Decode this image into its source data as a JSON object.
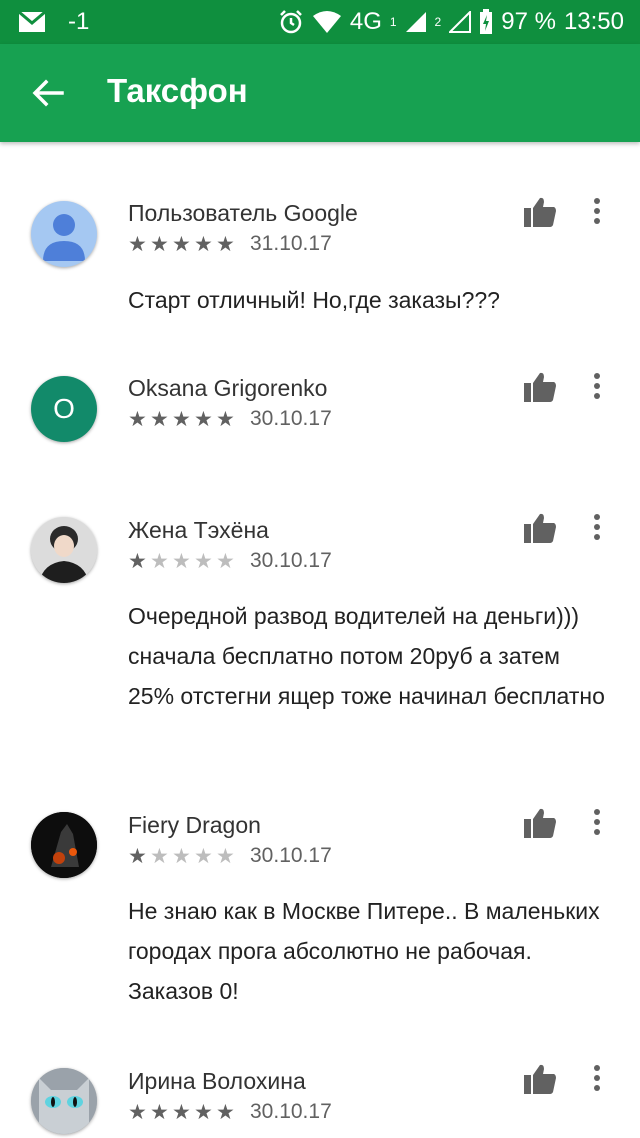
{
  "status_bar": {
    "notification_badge": "-1",
    "network": "4G",
    "sim1": "1",
    "sim2": "2",
    "battery": "97 %",
    "time": "13:50"
  },
  "app_bar": {
    "title": "Таксфон"
  },
  "reviews": [
    {
      "author": "Пользователь Google",
      "rating": 5,
      "stars": "★★★★★",
      "date": "31.10.17",
      "text": "Старт отличный! Но,где заказы???",
      "avatar": "default-user-avatar"
    },
    {
      "author": "Oksana Grigorenko",
      "rating": 5,
      "stars": "★★★★★",
      "date": "30.10.17",
      "text": "",
      "avatar_letter": "O"
    },
    {
      "author": "Жена Тэхёна",
      "rating": 1,
      "stars": "★★★★★",
      "date": "30.10.17",
      "text": "Очередной развод водителей на деньги))) сначала бесплатно потом 20руб а затем 25% отстегни ящер тоже начинал бесплатно",
      "avatar": "photo-avatar"
    },
    {
      "author": "Fiery Dragon",
      "rating": 1,
      "stars": "★★★★★",
      "date": "30.10.17",
      "text": "Не знаю как в Москве Питере.. В маленьких городах прога абсолютно не рабочая. Заказов 0!",
      "avatar": "photo-avatar"
    },
    {
      "author": "Ирина Волохина",
      "rating": 5,
      "stars": "★★★★★",
      "date": "30.10.17",
      "text": "",
      "avatar": "photo-avatar"
    }
  ],
  "colors": {
    "status_bar": "#0f8f3e",
    "app_bar": "#17a151",
    "star_on": "#616161",
    "star_off": "#bdbdbd"
  }
}
